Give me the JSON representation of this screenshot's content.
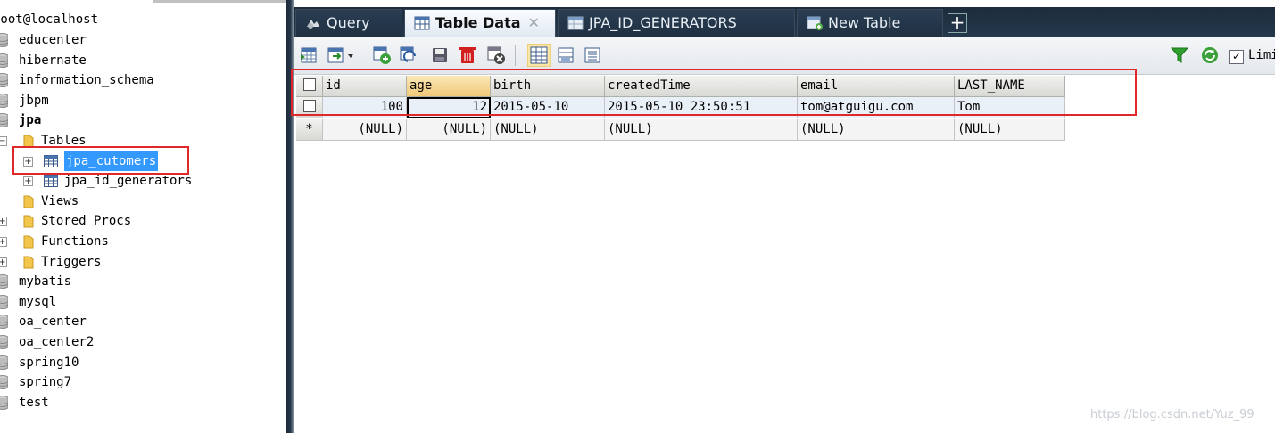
{
  "tree": {
    "root": "root@localhost",
    "databases_before": [
      "educenter",
      "hibernate",
      "information_schema",
      "jbpm"
    ],
    "active_db": "jpa",
    "folder_tables": "Tables",
    "tables": [
      "jpa_cutomers",
      "jpa_id_generators"
    ],
    "selected_table_index": 0,
    "folders_after": [
      "Views",
      "Stored Procs",
      "Functions",
      "Triggers"
    ],
    "databases_after": [
      "mybatis",
      "mysql",
      "oa_center",
      "oa_center2",
      "spring10",
      "spring7",
      "test"
    ]
  },
  "tabs": [
    {
      "label": "Query",
      "icon": "query-icon",
      "active": false
    },
    {
      "label": "Table Data",
      "icon": "table-icon",
      "active": true,
      "close": "✕"
    },
    {
      "label": "JPA_ID_GENERATORS",
      "icon": "table-icon",
      "active": false
    },
    {
      "label": "New Table",
      "icon": "new-table-icon",
      "active": false
    }
  ],
  "tab_add": "+",
  "toolbar": {
    "limit_label": "Limi",
    "limit_checked": true
  },
  "grid": {
    "columns": [
      "id",
      "age",
      "birth",
      "createdTime",
      "email",
      "LAST_NAME"
    ],
    "rows": [
      [
        "100",
        "12",
        "2015-05-10",
        "2015-05-10 23:50:51",
        "tom@atguigu.com",
        "Tom"
      ]
    ],
    "new_row_marker": "*",
    "null_text": "(NULL)"
  },
  "watermark": "https://blog.csdn.net/Yuz_99",
  "colors": {
    "annotation_red": "#e0282a",
    "selection_blue": "#3399ff",
    "tabbar_dark": "#1d2c3c"
  }
}
